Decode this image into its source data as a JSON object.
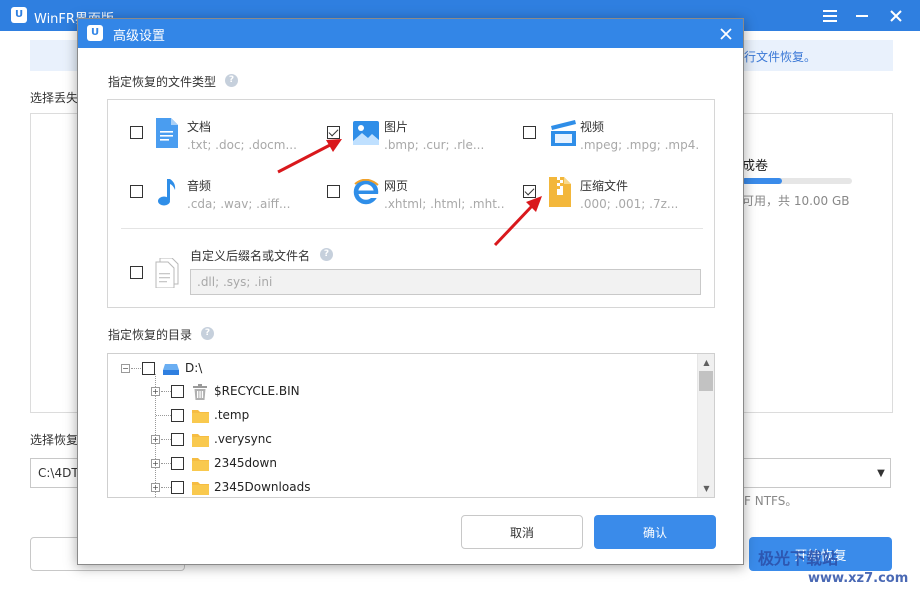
{
  "main": {
    "title": "WinFR界面版",
    "info_text": "行文件恢复。",
    "label_select_lost": "选择丢失",
    "volume_title": "成卷",
    "volume_text": "可用，共 10.00 GB",
    "label_select_recover": "选择恢复",
    "path_value": "C:\\4DT",
    "ntfs_text": "F NTFS。",
    "start_button": "开始恢复"
  },
  "watermark": {
    "text": "极光下载站",
    "url": "www.xz7.com"
  },
  "dialog": {
    "title": "高级设置",
    "types_label": "指定恢复的文件类型",
    "types": [
      {
        "name": "文档",
        "ext": ".txt; .doc; .docm...",
        "checked": false,
        "icon": "document-icon"
      },
      {
        "name": "图片",
        "ext": ".bmp; .cur; .rle...",
        "checked": true,
        "icon": "image-icon"
      },
      {
        "name": "视频",
        "ext": ".mpeg; .mpg; .mp4...",
        "checked": false,
        "icon": "video-icon"
      },
      {
        "name": "音频",
        "ext": ".cda; .wav; .aiff...",
        "checked": false,
        "icon": "music-icon"
      },
      {
        "name": "网页",
        "ext": ".xhtml; .html; .mht...",
        "checked": false,
        "icon": "web-icon"
      },
      {
        "name": "压缩文件",
        "ext": ".000; .001; .7z...",
        "checked": true,
        "icon": "archive-icon"
      }
    ],
    "custom_label": "自定义后缀名或文件名",
    "custom_placeholder": ".dll; .sys; .ini",
    "dir_label": "指定恢复的目录",
    "tree": [
      {
        "label": "D:\\",
        "icon": "drive-icon",
        "level": 0,
        "expander": "−"
      },
      {
        "label": "$RECYCLE.BIN",
        "icon": "recycle-bin-icon",
        "level": 1,
        "expander": "+"
      },
      {
        "label": ".temp",
        "icon": "folder-icon",
        "level": 1,
        "expander": ""
      },
      {
        "label": ".verysync",
        "icon": "folder-icon",
        "level": 1,
        "expander": "+"
      },
      {
        "label": "2345down",
        "icon": "folder-icon",
        "level": 1,
        "expander": "+"
      },
      {
        "label": "2345Downloads",
        "icon": "folder-icon",
        "level": 1,
        "expander": "+"
      }
    ],
    "cancel_label": "取消",
    "ok_label": "确认"
  },
  "colors": {
    "titlebar": "#3386e7",
    "primary_button": "#3a8bea",
    "arrow": "#d9181c"
  }
}
